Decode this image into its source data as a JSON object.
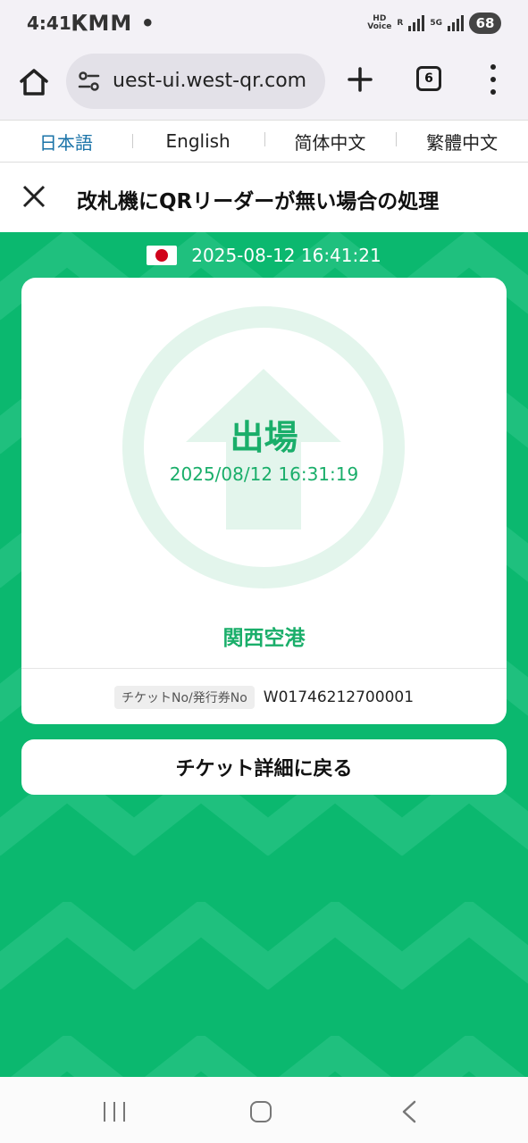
{
  "status_bar": {
    "time": "4:41",
    "notifications": "𝐊MM •",
    "hd_voice_top": "HD",
    "hd_voice_bottom": "Voice",
    "network_label": "5G",
    "roaming_label": "R",
    "battery": "68"
  },
  "browser": {
    "url": "uest-ui.west-qr.com",
    "tab_count": "6"
  },
  "languages": [
    {
      "label": "日本語",
      "active": true
    },
    {
      "label": "English",
      "active": false
    },
    {
      "label": "简体中文",
      "active": false
    },
    {
      "label": "繁體中文",
      "active": false
    }
  ],
  "header": {
    "title": "改札機にQRリーダーが無い場合の処理"
  },
  "main": {
    "current_datetime": "2025-08-12 16:41:21",
    "card": {
      "status_label": "出場",
      "status_time": "2025/08/12 16:31:19",
      "station": "関西空港",
      "ticket_no_label": "チケットNo/発行券No",
      "ticket_no_value": "W01746212700001"
    },
    "back_button_label": "チケット詳細に戻る"
  },
  "colors": {
    "accent_green": "#0bb86f",
    "text_green": "#1aae6a",
    "link_blue": "#1a73a8"
  }
}
